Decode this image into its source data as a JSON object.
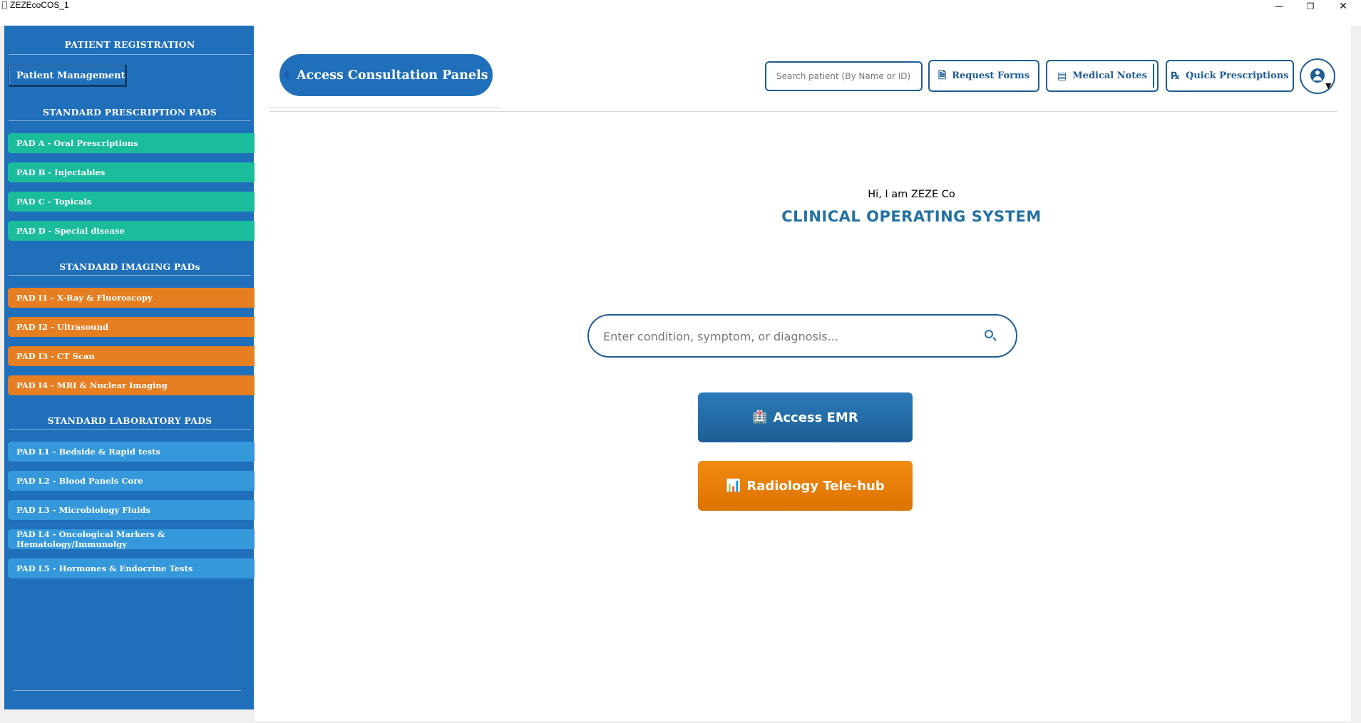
{
  "window": {
    "title": "ZEZEcoCOS_1",
    "controls": {
      "minimize": "—",
      "maximize": "❐",
      "close": "✕"
    }
  },
  "sidebar": {
    "patient_registration_header": "PATIENT REGISTRATION",
    "patient_management_label": "Patient Management",
    "prescription_header": "STANDARD PRESCRIPTION PADS",
    "prescription_pads": [
      "PAD A - Oral Prescriptions",
      "PAD B - Injectables",
      "PAD C - Topicals",
      "PAD D - Special disease"
    ],
    "imaging_header": "STANDARD IMAGING PADs",
    "imaging_pads": [
      "PAD I1 - X-Ray & Fluoroscopy",
      "PAD I2 - Ultrasound",
      "PAD I3 - CT Scan",
      "PAD I4 - MRI & Nuclear Imaging"
    ],
    "laboratory_header": "STANDARD LABORATORY PADS",
    "laboratory_pads": [
      "PAD L1 - Bedside & Rapid tests",
      "PAD L2 - Blood Panels Core",
      "PAD L3 - Microbiology Fluids",
      "PAD L4 - Oncological Markers & Hematology/Immunolgy",
      "PAD L5 - Hormones & Endocrine Tests"
    ],
    "colors": {
      "background": "#1f6fba",
      "prescription": "#1abc9c",
      "imaging": "#e67e22",
      "laboratory": "#3498db"
    }
  },
  "header": {
    "consultation_button": "Access Consultation Panels",
    "search_placeholder": "Search patient (By Name or ID)",
    "request_forms": "Request Forms",
    "medical_notes": "Medical Notes",
    "quick_prescriptions": "Quick Prescriptions"
  },
  "main": {
    "greeting": "Hi, I am ZEZE Co",
    "title": "CLINICAL OPERATING SYSTEM",
    "condition_search_placeholder": "Enter condition, symptom, or diagnosis...",
    "emr_button": "Access EMR",
    "radiology_button": "Radiology Tele-hub",
    "colors": {
      "accent": "#2471a3",
      "emr": "#1f6fba",
      "radiology": "#e67e22"
    }
  }
}
